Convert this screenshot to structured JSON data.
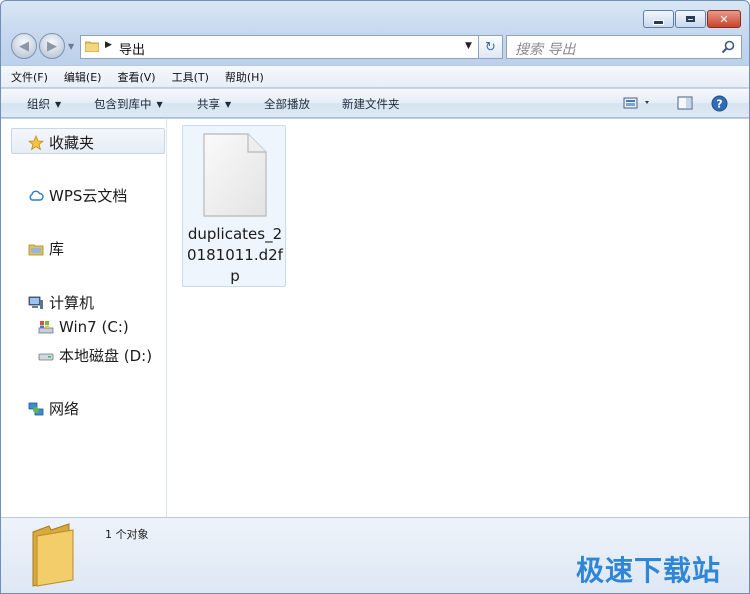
{
  "window": {
    "title": "导出"
  },
  "address": {
    "current_folder": "导出",
    "search_placeholder": "搜索 导出"
  },
  "menu": [
    "文件(F)",
    "编辑(E)",
    "查看(V)",
    "工具(T)",
    "帮助(H)"
  ],
  "toolbar": {
    "organize": "组织",
    "include_in_library": "包含到库中",
    "share": "共享",
    "play_all": "全部播放",
    "new_folder": "新建文件夹",
    "help_glyph": "?"
  },
  "navpane": {
    "favorites": "收藏夹",
    "wps_cloud": "WPS云文档",
    "libraries": "库",
    "computer": "计算机",
    "drive_c": "Win7 (C:)",
    "drive_d": "本地磁盘 (D:)",
    "network": "网络"
  },
  "files": [
    {
      "name": "duplicates_20181011.d2fp",
      "icon": "generic-document-icon"
    }
  ],
  "status": {
    "item_count": "1 个对象"
  },
  "watermark": {
    "text": "极速下载站"
  },
  "colors": {
    "accent": "#2f86d6",
    "selection": "#eef5fc",
    "close": "#c8442c"
  }
}
